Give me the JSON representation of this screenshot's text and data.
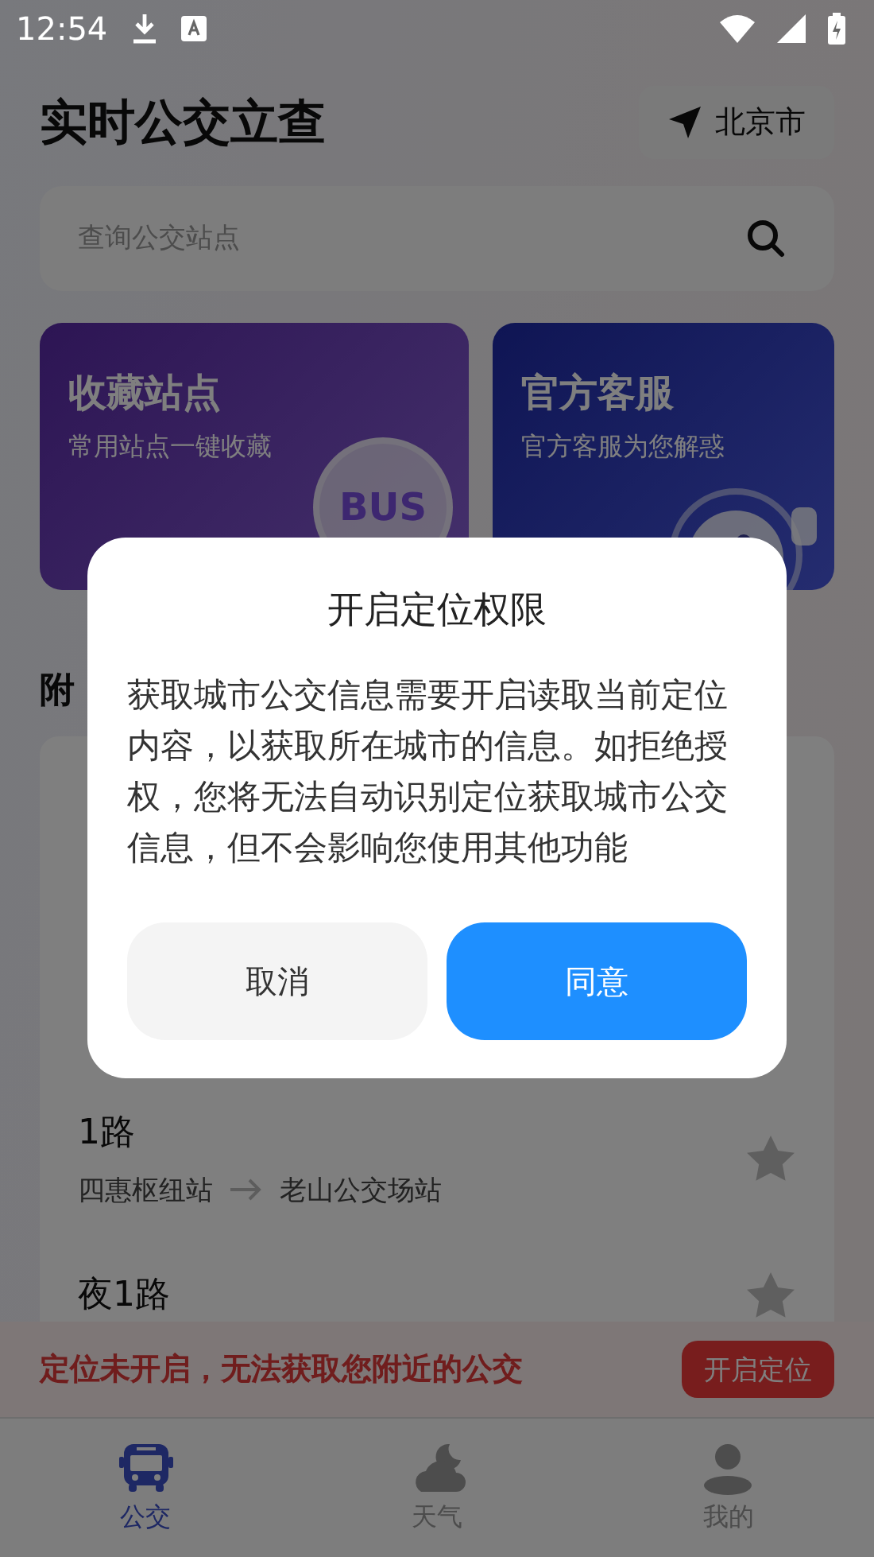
{
  "status_bar": {
    "time": "12:54"
  },
  "header": {
    "title": "实时公交立查",
    "city": "北京市"
  },
  "search": {
    "placeholder": "查询公交站点"
  },
  "cards": [
    {
      "kind": "favorites",
      "title": "收藏站点",
      "subtitle": "常用站点一键收藏",
      "badge": "BUS"
    },
    {
      "kind": "service",
      "title": "官方客服",
      "subtitle": "官方客服为您解惑"
    }
  ],
  "nearby": {
    "heading": "附",
    "routes": [
      {
        "name": "1路",
        "from": "四惠枢纽站",
        "to": "老山公交场站",
        "starred": false
      },
      {
        "name": "夜1路",
        "starred": false
      }
    ]
  },
  "banner": {
    "message": "定位未开启，无法获取您附近的公交",
    "button": "开启定位"
  },
  "tabs": [
    {
      "label": "公交",
      "selected": true
    },
    {
      "label": "天气",
      "selected": false
    },
    {
      "label": "我的",
      "selected": false
    }
  ],
  "dialog": {
    "title": "开启定位权限",
    "body": "获取城市公交信息需要开启读取当前定位内容，以获取所在城市的信息。如拒绝授权，您将无法自动识别定位获取城市公交信息，但不会影响您使用其他功能",
    "buttons": [
      {
        "label": "取消",
        "kind": "secondary"
      },
      {
        "label": "同意",
        "kind": "primary"
      }
    ]
  }
}
